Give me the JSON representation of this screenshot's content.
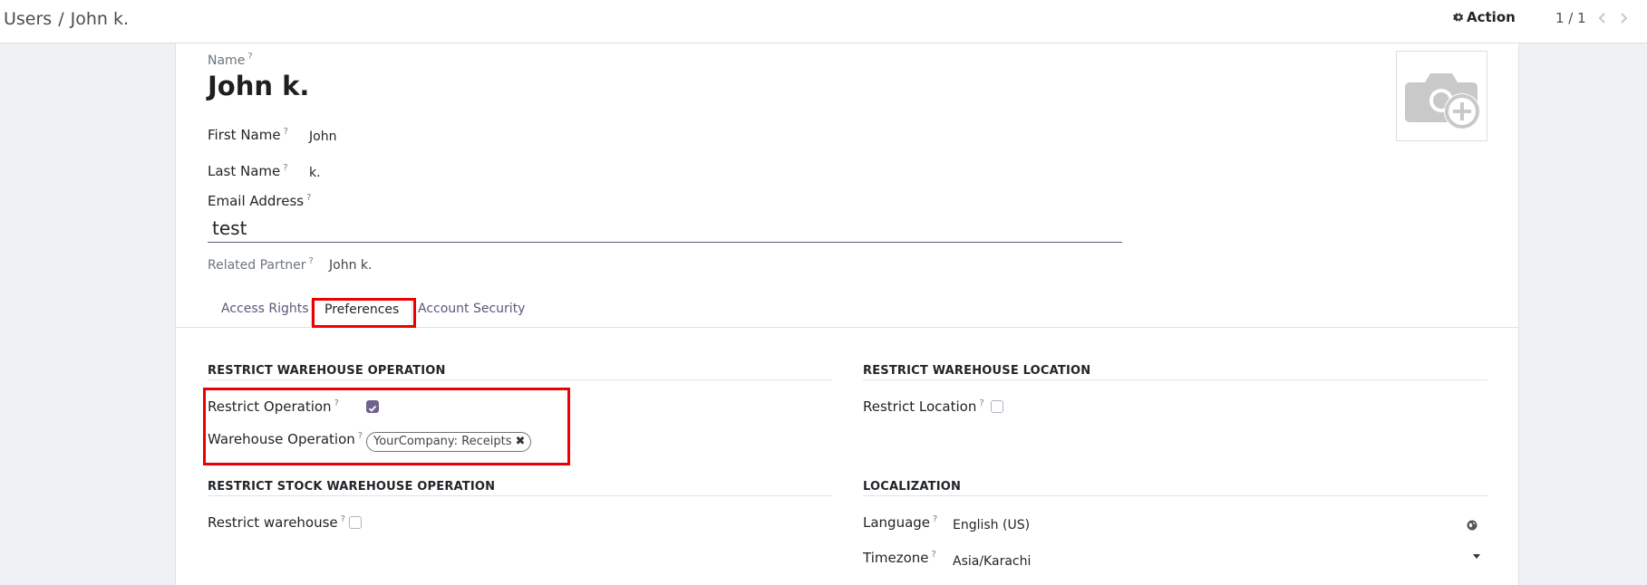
{
  "breadcrumb": {
    "parent": "Users",
    "separator": "/",
    "current": "John k."
  },
  "toolbar": {
    "action_label": "Action",
    "pager": "1 / 1"
  },
  "form": {
    "name_label": "Name",
    "name_value": "John k.",
    "first_name_label": "First Name",
    "first_name_value": "John",
    "last_name_label": "Last Name",
    "last_name_value": "k.",
    "email_label": "Email Address",
    "email_value": "test",
    "related_partner_label": "Related Partner",
    "related_partner_value": "John k.",
    "help_mark": "?"
  },
  "tabs": [
    {
      "label": "Access Rights"
    },
    {
      "label": "Preferences",
      "active": true
    },
    {
      "label": "Account Security"
    }
  ],
  "sections": {
    "restrict_warehouse_operation": {
      "title": "RESTRICT WAREHOUSE OPERATION",
      "restrict_operation_label": "Restrict Operation",
      "restrict_operation_checked": true,
      "warehouse_operation_label": "Warehouse Operation",
      "warehouse_operation_tags": [
        "YourCompany: Receipts"
      ]
    },
    "restrict_warehouse_location": {
      "title": "RESTRICT WAREHOUSE LOCATION",
      "restrict_location_label": "Restrict Location",
      "restrict_location_checked": false
    },
    "restrict_stock_warehouse_operation": {
      "title": "RESTRICT STOCK WAREHOUSE OPERATION",
      "restrict_warehouse_label": "Restrict warehouse",
      "restrict_warehouse_checked": false
    },
    "localization": {
      "title": "LOCALIZATION",
      "language_label": "Language",
      "language_value": "English (US)",
      "timezone_label": "Timezone",
      "timezone_value": "Asia/Karachi"
    }
  },
  "icons": {
    "settings": "gear-icon",
    "prev": "chevron-left-icon",
    "next": "chevron-right-icon",
    "avatar": "camera-plus-icon",
    "remove_tag": "close-icon",
    "language": "globe-icon",
    "timezone": "caret-down-icon"
  },
  "colors": {
    "accent": "#6d638d",
    "highlight": "#ec0000",
    "link": "#5d577d"
  }
}
